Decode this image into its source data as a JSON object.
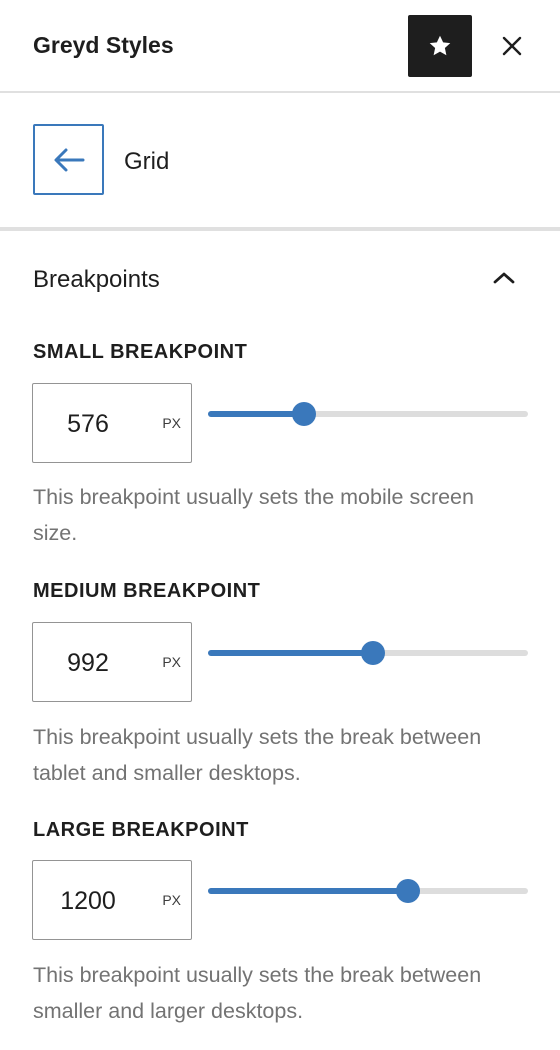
{
  "header": {
    "title": "Greyd Styles",
    "star_icon": "star-icon",
    "close_icon": "close-icon"
  },
  "navigation": {
    "back_icon": "arrow-left-icon",
    "title": "Grid"
  },
  "panel": {
    "title": "Breakpoints",
    "toggle_icon": "chevron-up-icon",
    "breakpoints": [
      {
        "label": "SMALL BREAKPOINT",
        "value": "576",
        "unit": "PX",
        "slider_fraction": 0.3,
        "help": "This breakpoint usually sets the mobile screen size."
      },
      {
        "label": "MEDIUM BREAKPOINT",
        "value": "992",
        "unit": "PX",
        "slider_fraction": 0.516,
        "help": "This breakpoint usually sets the break between tablet and smaller desktops."
      },
      {
        "label": "LARGE BREAKPOINT",
        "value": "1200",
        "unit": "PX",
        "slider_fraction": 0.625,
        "help": "This breakpoint usually sets the break between smaller and larger desktops."
      }
    ]
  },
  "colors": {
    "accent": "#3a78bb",
    "dark": "#1e1e1e",
    "muted_text": "#737373",
    "track": "#dddddd"
  }
}
